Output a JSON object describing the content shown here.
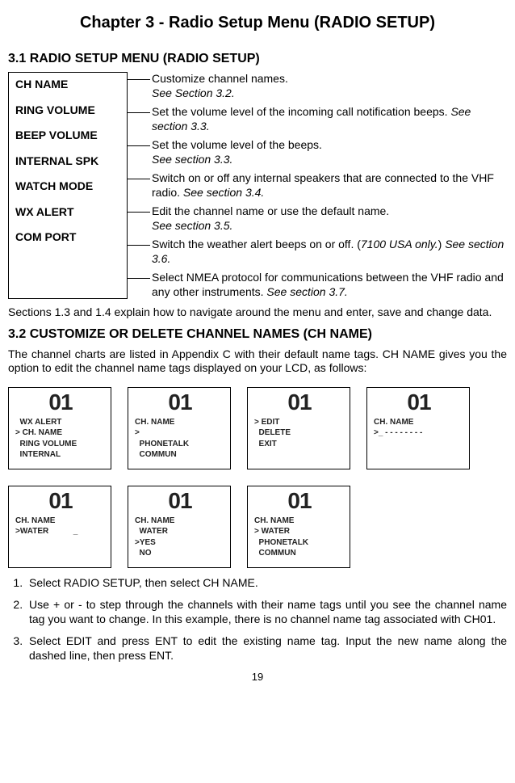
{
  "chapter_title": "Chapter 3 - Radio Setup Menu (RADIO SETUP)",
  "section_3_1": {
    "heading": "3.1 RADIO SETUP MENU (RADIO SETUP)",
    "menu_items": {
      "0": {
        "label": "CH NAME",
        "desc": "Customize channel names.",
        "see": "See Section 3.2."
      },
      "1": {
        "label": "RING VOLUME",
        "desc": "Set the volume level of the incoming call notification beeps. ",
        "see": "See section 3.3."
      },
      "2": {
        "label": "BEEP VOLUME",
        "desc": "Set the volume level of the beeps.",
        "see": "See section 3.3."
      },
      "3": {
        "label": "INTERNAL SPK",
        "desc": "Switch on or off any internal speakers that are connected to the VHF radio. ",
        "see": "See section 3.4."
      },
      "4": {
        "label": "WATCH MODE",
        "desc": "Edit the channel name or use the default name.",
        "see": "See section 3.5."
      },
      "5": {
        "label": "WX ALERT",
        "desc_pre": "Switch the weather alert beeps on or off. (",
        "desc_ital": "7100 USA only.",
        "desc_post": ") ",
        "see": "See section 3.6."
      },
      "6": {
        "label": "COM PORT",
        "desc": "Select NMEA protocol for communications between the VHF radio and any other instruments. ",
        "see": "See section 3.7."
      }
    },
    "after_para": "Sections 1.3 and 1.4 explain how to navigate around the menu and enter, save and change data."
  },
  "section_3_2": {
    "heading": "3.2 CUSTOMIZE OR DELETE CHANNEL NAMES (CH NAME)",
    "intro": "The channel charts are listed in Appendix C with their default name tags. CH NAME gives you the option to edit the channel name tags displayed on your LCD, as follows:",
    "screens": {
      "0": {
        "big": "01",
        "lines": "  WX ALERT\n> CH. NAME\n  RING VOLUME\n  INTERNAL"
      },
      "1": {
        "big": "01",
        "lines": "CH. NAME\n>\n  PHONETALK\n  COMMUN"
      },
      "2": {
        "big": "01",
        "lines": "> EDIT\n  DELETE\n  EXIT"
      },
      "3": {
        "big": "01",
        "lines": "CH. NAME\n>_ - - - - - - - -"
      },
      "4": {
        "big": "01",
        "lines": "CH. NAME\n>WATER           _"
      },
      "5": {
        "big": "01",
        "lines": "CH. NAME\n  WATER\n>YES\n  NO"
      },
      "6": {
        "big": "01",
        "lines": "CH. NAME\n> WATER\n  PHONETALK\n  COMMUN"
      }
    },
    "steps": {
      "0": "Select RADIO SETUP, then select CH NAME.",
      "1": "Use + or - to step through the channels with their name tags until you see the channel name tag you want to change. In this example, there is no channel name tag associated with CH01.",
      "2": "Select EDIT and press ENT to edit the existing name tag. Input the new name along the dashed line, then press ENT."
    }
  },
  "page_number": "19"
}
